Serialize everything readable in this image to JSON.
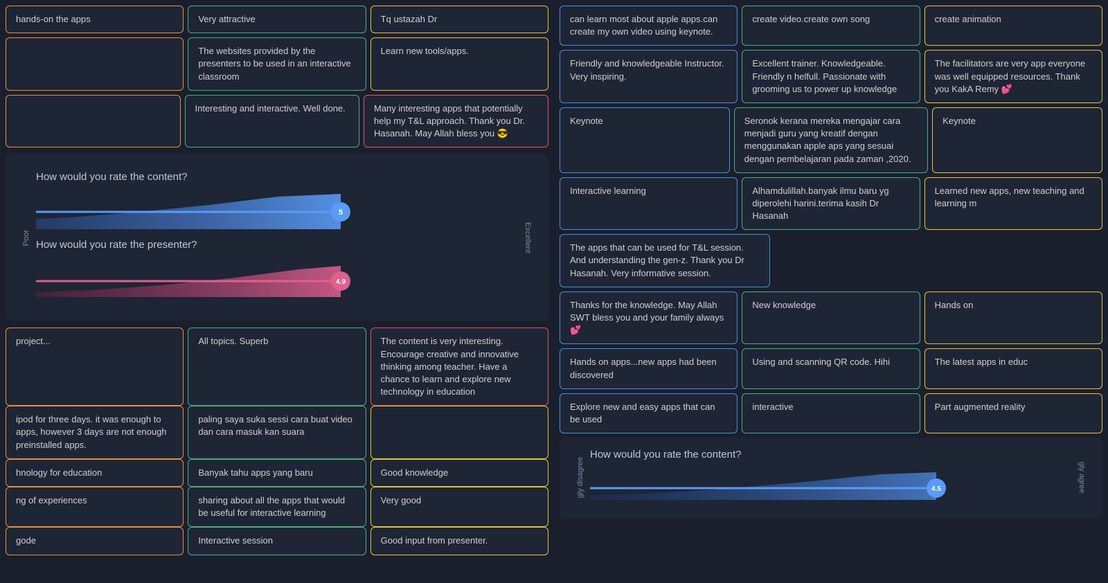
{
  "left": {
    "top_row": [
      {
        "text": "hands-on the apps",
        "border": "orange"
      },
      {
        "text": "Very attractive",
        "border": "green"
      },
      {
        "text": "Tq ustazah Dr",
        "border": "yellow"
      }
    ],
    "row2": [
      {
        "text": "",
        "border": "orange"
      },
      {
        "text": "The websites provided by the presenters to be used in an interactive classroom",
        "border": "green"
      },
      {
        "text": "Learn new tools/apps.",
        "border": "yellow"
      }
    ],
    "row3": [
      {
        "text": "",
        "border": "orange"
      },
      {
        "text": "Interesting and interactive. Well done.",
        "border": "green"
      },
      {
        "text": "Many interesting apps that potentially help my T&L approach. Thank you Dr. Hasanah. May Allah bless you 😎",
        "border": "red"
      }
    ],
    "rating_section": {
      "title1": "How would you rate the content?",
      "score1": "5",
      "title2": "How would you rate the presenter?",
      "score2": "4.9",
      "axis_left": "Poor",
      "axis_right": "Excellent"
    },
    "bottom_rows": [
      [
        {
          "text": "project...",
          "border": "orange"
        },
        {
          "text": "All topics. Superb",
          "border": "green"
        },
        {
          "text": "The content is very interesting. Encourage creative and innovative thinking among teacher. Have a chance to learn and explore new technology in education",
          "border": "red"
        }
      ],
      [
        {
          "text": "ipod for three days. it was enough to apps, however 3 days are not enough preinstalled apps.",
          "border": "orange"
        },
        {
          "text": "paling saya suka sessi cara buat video dan cara masuk kan suara",
          "border": "green"
        },
        {
          "text": "",
          "border": "yellow"
        }
      ],
      [
        {
          "text": "hnology for education",
          "border": "orange"
        },
        {
          "text": "Banyak tahu apps yang baru",
          "border": "green"
        },
        {
          "text": "Good knowledge",
          "border": "yellow"
        }
      ],
      [
        {
          "text": "ng of experiences",
          "border": "orange"
        },
        {
          "text": "sharing about all the apps that would be useful for interactive learning",
          "border": "green"
        },
        {
          "text": "Very good",
          "border": "yellow"
        }
      ],
      [
        {
          "text": "gode",
          "border": "orange"
        },
        {
          "text": "Interactive session",
          "border": "green"
        },
        {
          "text": "Good input from presenter.",
          "border": "yellow"
        }
      ]
    ]
  },
  "right": {
    "top_row": [
      {
        "text": "can learn most about apple apps.can create my own video using keynote.",
        "border": "blue"
      },
      {
        "text": "create video.create own song",
        "border": "green"
      },
      {
        "text": "create animation",
        "border": "yellow"
      }
    ],
    "row2": [
      {
        "text": "Friendly and knowledgeable Instructor. Very inspiring.",
        "border": "blue"
      },
      {
        "text": "Excellent trainer. Knowledgeable. Friendly n helfull. Passionate with grooming us to power up knowledge",
        "border": "green"
      },
      {
        "text": "The facilitators are very app everyone was well equipped resources. Thank you KakA Remy 💕",
        "border": "yellow"
      }
    ],
    "row3": [
      {
        "text": "Keynote",
        "border": "blue"
      },
      {
        "text": "Seronok kerana mereka mengajar cara menjadi guru yang kreatif dengan menggunakan apple aps yang sesuai dengan pembelajaran pada zaman ,2020.",
        "border": "green"
      },
      {
        "text": "Keynote",
        "border": "yellow"
      }
    ],
    "row4": [
      {
        "text": "Interactive learning",
        "border": "blue"
      },
      {
        "text": "Alhamdulillah.banyak ilmu baru yg diperolehi harini.terima kasih Dr Hasanah",
        "border": "green"
      },
      {
        "text": "Learned new apps, new teaching and learning m",
        "border": "yellow"
      }
    ],
    "row5": [
      {
        "text": "The apps that can be used for T&L session. And understanding the gen-z. Thank you Dr Hasanah. Very informative session.",
        "border": "blue"
      },
      {
        "text": "",
        "border": ""
      },
      {
        "text": "",
        "border": ""
      }
    ],
    "row6": [
      {
        "text": "Thanks for the knowledge. May Allah SWT bless you and your family always 💕",
        "border": "blue"
      },
      {
        "text": "New knowledge",
        "border": "green"
      },
      {
        "text": "Hands on",
        "border": "yellow"
      }
    ],
    "row7": [
      {
        "text": "Hands on apps...new apps had been discovered",
        "border": "blue"
      },
      {
        "text": "Using and scanning QR code. Hihi",
        "border": "green"
      },
      {
        "text": "The latest apps in educ",
        "border": "yellow"
      }
    ],
    "row8": [
      {
        "text": "Explore new and easy apps that can be used",
        "border": "blue"
      },
      {
        "text": "interactive",
        "border": "green"
      },
      {
        "text": "Part augmented reality",
        "border": "yellow"
      }
    ],
    "bottom_rating": {
      "title": "How would you rate the content?",
      "score": "4.5",
      "axis_left": "gly disagree",
      "axis_right": "gly agree"
    }
  }
}
